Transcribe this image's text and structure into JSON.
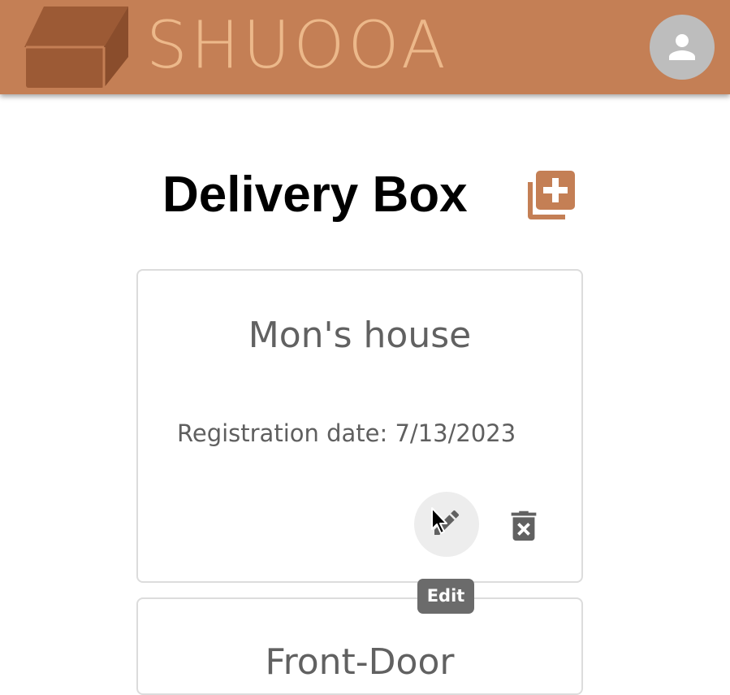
{
  "header": {
    "brand": "SHUOOA",
    "logo_icon": "delivery-box-logo",
    "avatar_icon": "person-icon",
    "bar_color": "#c47f55",
    "brand_color": "#ecb88a"
  },
  "main": {
    "title": "Delivery Box",
    "add_icon": "library-add-icon",
    "accent_color": "#c47f55"
  },
  "boxes": [
    {
      "name": "Mon's house",
      "registration": "Registration date: 7/13/2023",
      "edit_icon": "pencil-icon",
      "delete_icon": "trash-x-icon"
    },
    {
      "name": "Front-Door"
    }
  ],
  "tooltip": {
    "label": "Edit"
  }
}
